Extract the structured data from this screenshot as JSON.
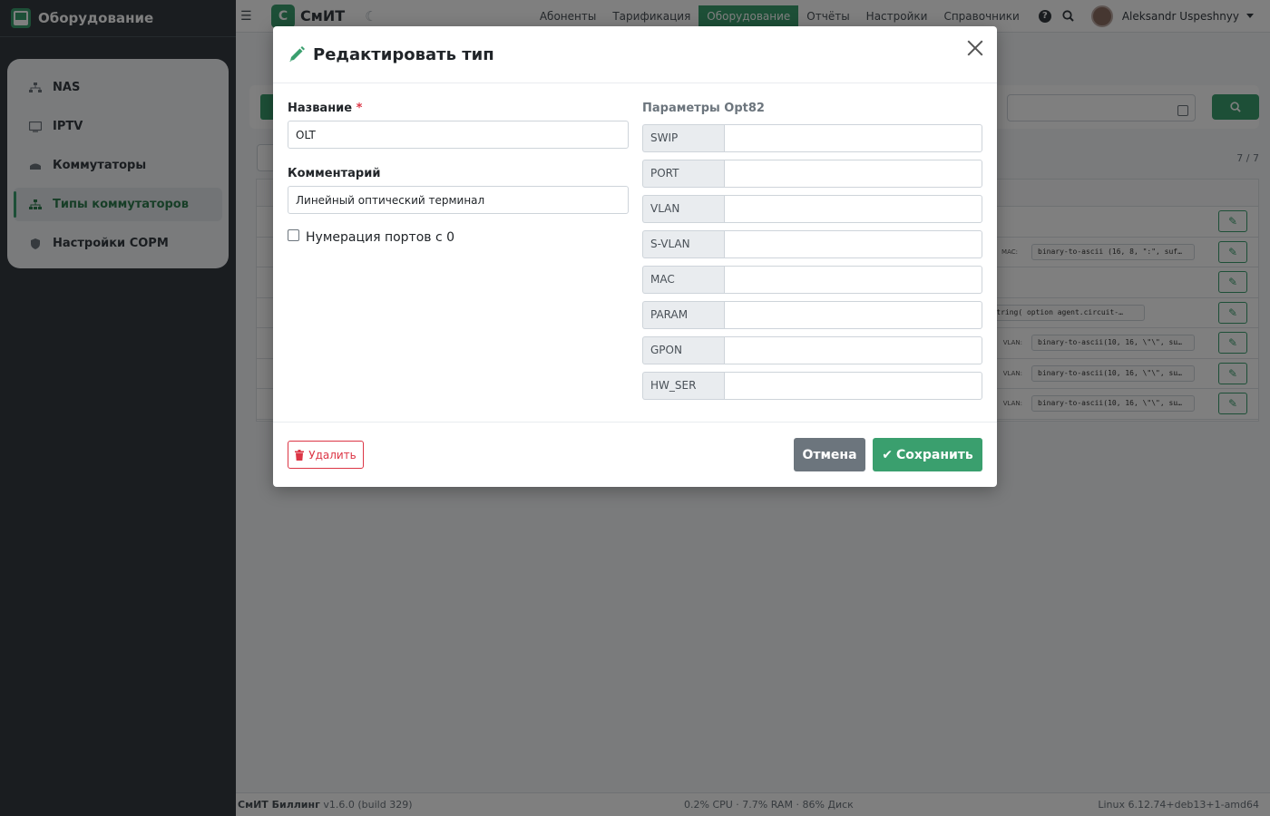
{
  "sidebar": {
    "brand": "Оборудование",
    "items": [
      {
        "label": "NAS",
        "icon": "network-icon"
      },
      {
        "label": "IPTV",
        "icon": "tv-icon"
      },
      {
        "label": "Коммутаторы",
        "icon": "switch-icon"
      },
      {
        "label": "Типы коммутаторов",
        "icon": "sitemap-icon"
      },
      {
        "label": "Настройки СОРМ",
        "icon": "shield-icon"
      }
    ],
    "active_index": 3
  },
  "topbar": {
    "logo_letter": "С",
    "logo_text": "СмИТ",
    "menu": [
      "Абоненты",
      "Тарификация",
      "Оборудование",
      "Отчёты",
      "Настройки",
      "Справочники"
    ],
    "active_menu": "Оборудование",
    "username": "Aleksandr Uspeshnyy"
  },
  "background": {
    "count": "7 / 7",
    "rows": [
      {
        "mac_label": "",
        "code": ""
      },
      {
        "mac_label": "MAC:",
        "code": "binary-to-ascii (16, 8, \":\", suf…"
      },
      {
        "mac_label": "",
        "code": ""
      },
      {
        "mac_label": "",
        "code": "substring( option agent.circuit-…"
      },
      {
        "mac_label": "VLAN:",
        "code": "binary-to-ascii(10, 16, \\\"\\\", su…"
      },
      {
        "mac_label": "VLAN:",
        "code": "binary-to-ascii(10, 16, \\\"\\\", su…"
      },
      {
        "mac_label": "VLAN:",
        "code": "binary-to-ascii(10, 16, \\\"\\\", su…"
      }
    ]
  },
  "footer": {
    "app": "СмИТ Биллинг",
    "version": "v1.6.0 (build 329)",
    "stats": "0.2% CPU · 7.7% RAM · 86% Диск",
    "os": "Linux 6.12.74+deb13+1-amd64"
  },
  "modal": {
    "title": "Редактировать тип",
    "name_label": "Название",
    "required_mark": "*",
    "name_value": "OLT",
    "comment_label": "Комментарий",
    "comment_value": "Линейный оптический терминал",
    "zero_ports_label": "Нумерация портов с 0",
    "zero_ports_checked": false,
    "opt82_title": "Параметры Opt82",
    "opt82": [
      {
        "key": "SWIP",
        "value": ""
      },
      {
        "key": "PORT",
        "value": ""
      },
      {
        "key": "VLAN",
        "value": ""
      },
      {
        "key": "S-VLAN",
        "value": ""
      },
      {
        "key": "MAC",
        "value": ""
      },
      {
        "key": "PARAM",
        "value": ""
      },
      {
        "key": "GPON",
        "value": ""
      },
      {
        "key": "HW_SER",
        "value": ""
      }
    ],
    "delete_label": "Удалить",
    "cancel_label": "Отмена",
    "save_label": "Сохранить"
  },
  "colors": {
    "accent": "#3a9f6e",
    "danger": "#dc3545",
    "secondary": "#6c757d",
    "sidebar_bg": "#343a40"
  }
}
